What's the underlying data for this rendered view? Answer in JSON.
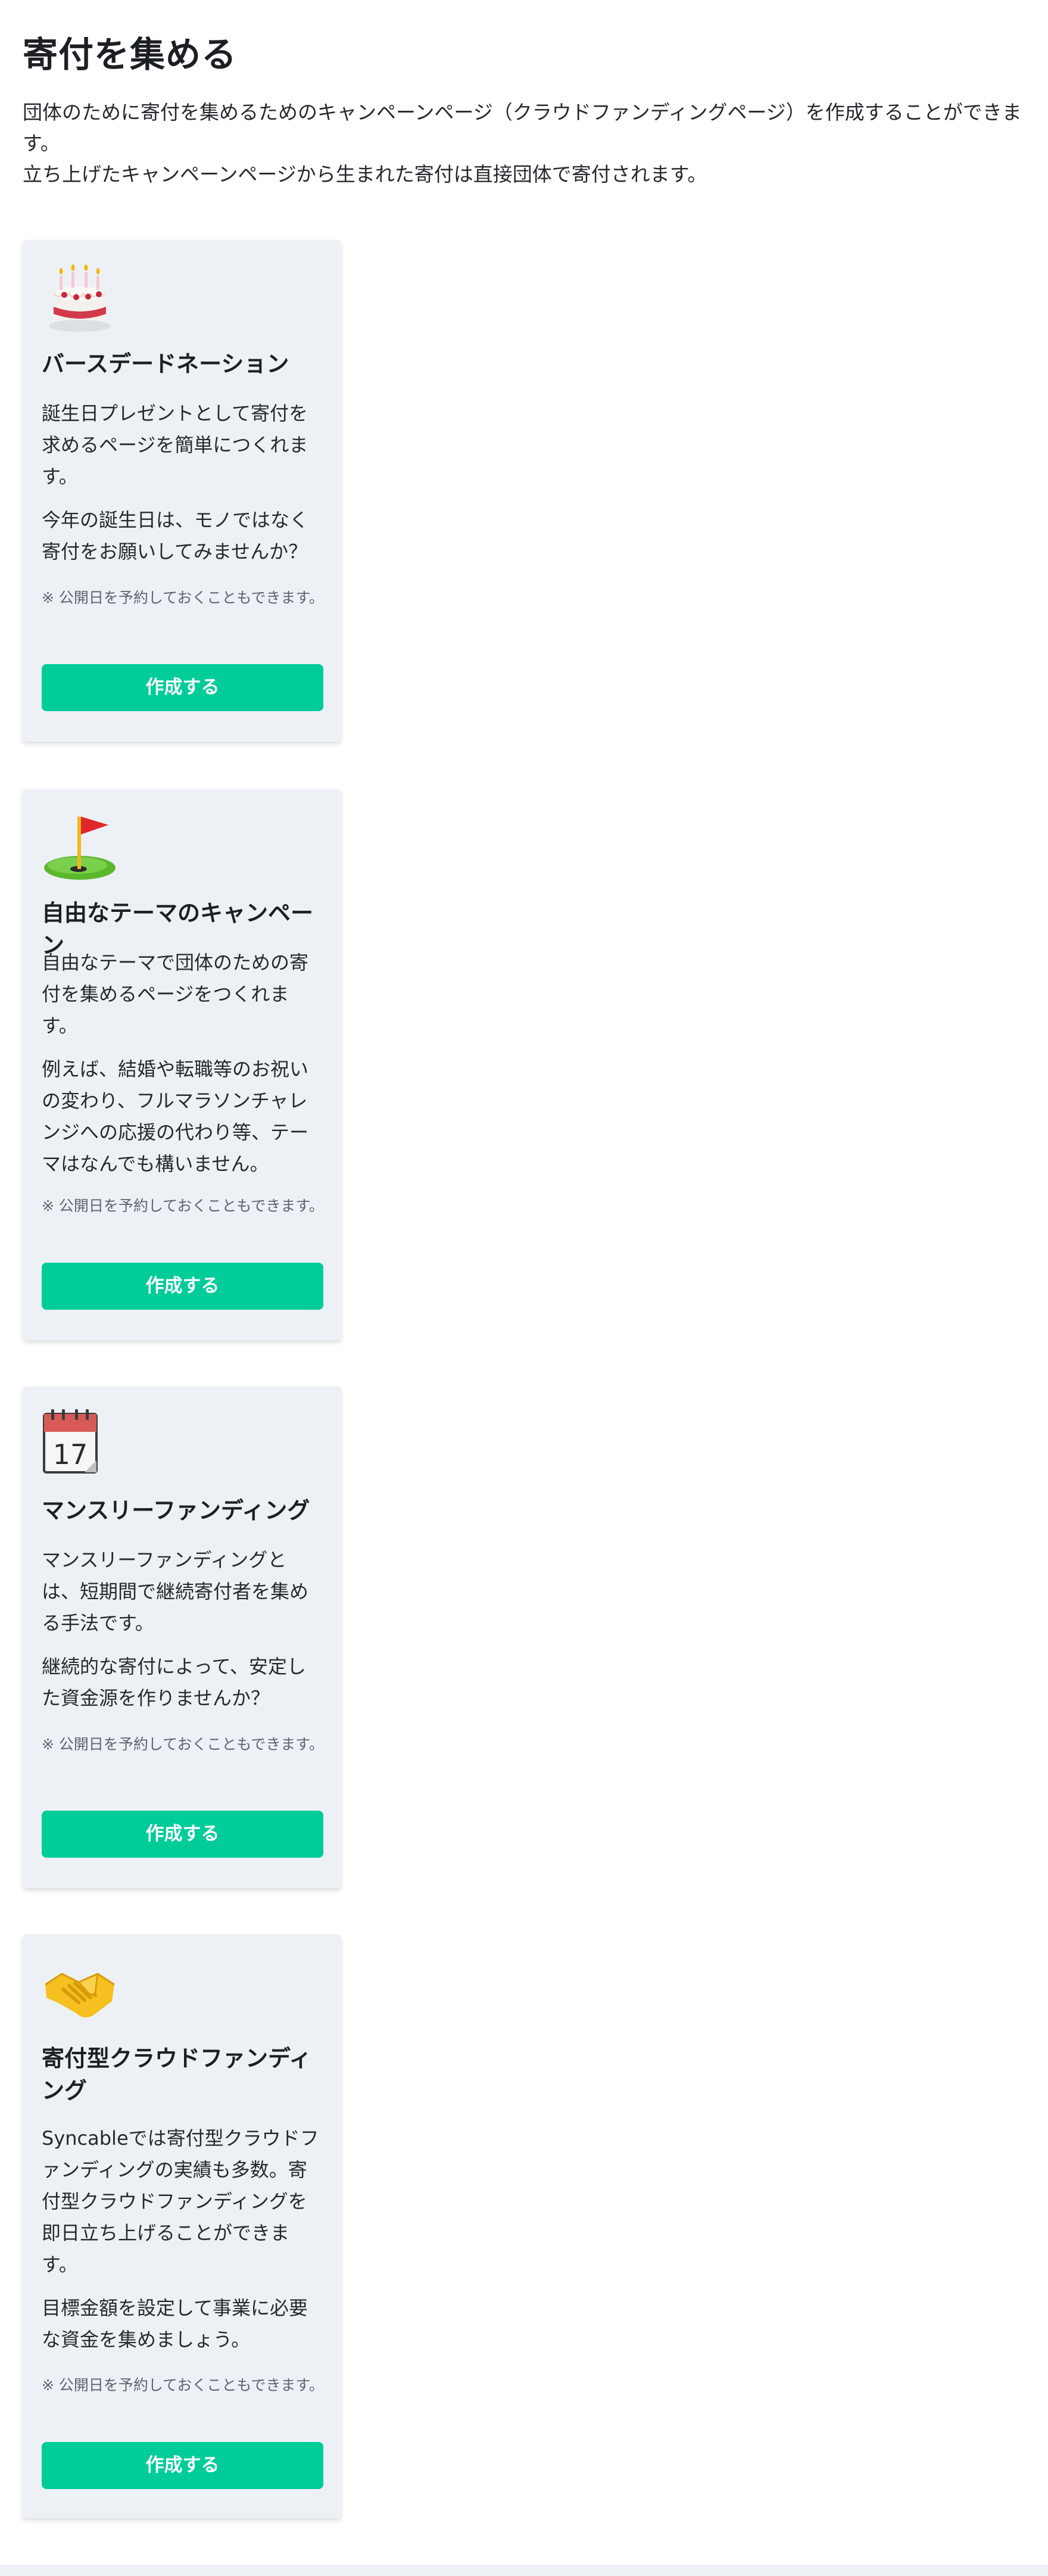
{
  "header": {
    "title": "寄付を集める",
    "intro_line1": "団体のために寄付を集めるためのキャンペーンページ（クラウドファンディングページ）を作成することができます。",
    "intro_line2": "立ち上げたキャンペーンページから生まれた寄付は直接団体で寄付されます。"
  },
  "cards": [
    {
      "icon": "birthday-cake-icon",
      "title": "バースデードネーション",
      "paragraphs": [
        "誕生日プレゼントとして寄付を求めるページを簡単につくれます。",
        "今年の誕生日は、モノではなく寄付をお願いしてみませんか？"
      ],
      "note": "※ 公開日を予約しておくこともできます。",
      "button_label": "作成する"
    },
    {
      "icon": "golf-flag-icon",
      "title": "自由なテーマのキャンペーン",
      "paragraphs": [
        "自由なテーマで団体のための寄付を集めるページをつくれます。",
        "例えば、結婚や転職等のお祝いの変わり、フルマラソンチャレンジへの応援の代わり等、テーマはなんでも構いません。"
      ],
      "note": "※ 公開日を予約しておくこともできます。",
      "button_label": "作成する"
    },
    {
      "icon": "calendar-icon",
      "calendar_day": "17",
      "title": "マンスリーファンディング",
      "paragraphs": [
        "マンスリーファンディングとは、短期間で継続寄付者を集める手法です。",
        "継続的な寄付によって、安定した資金源を作りませんか？"
      ],
      "note": "※ 公開日を予約しておくこともできます。",
      "button_label": "作成する"
    },
    {
      "icon": "handshake-icon",
      "title": "寄付型クラウドファンディング",
      "paragraphs": [
        "Syncableでは寄付型クラウドファンディングの実績も多数。寄付型クラウドファンディングを即日立ち上げることができます。",
        "目標金額を設定して事業に必要な資金を集めましょう。"
      ],
      "note": "※ 公開日を予約しておくこともできます。",
      "button_label": "作成する"
    }
  ],
  "colors": {
    "accent": "#00cc9a",
    "card_background": "#edf1f6",
    "text": "#1c1f24",
    "note_text": "#5d6470"
  }
}
